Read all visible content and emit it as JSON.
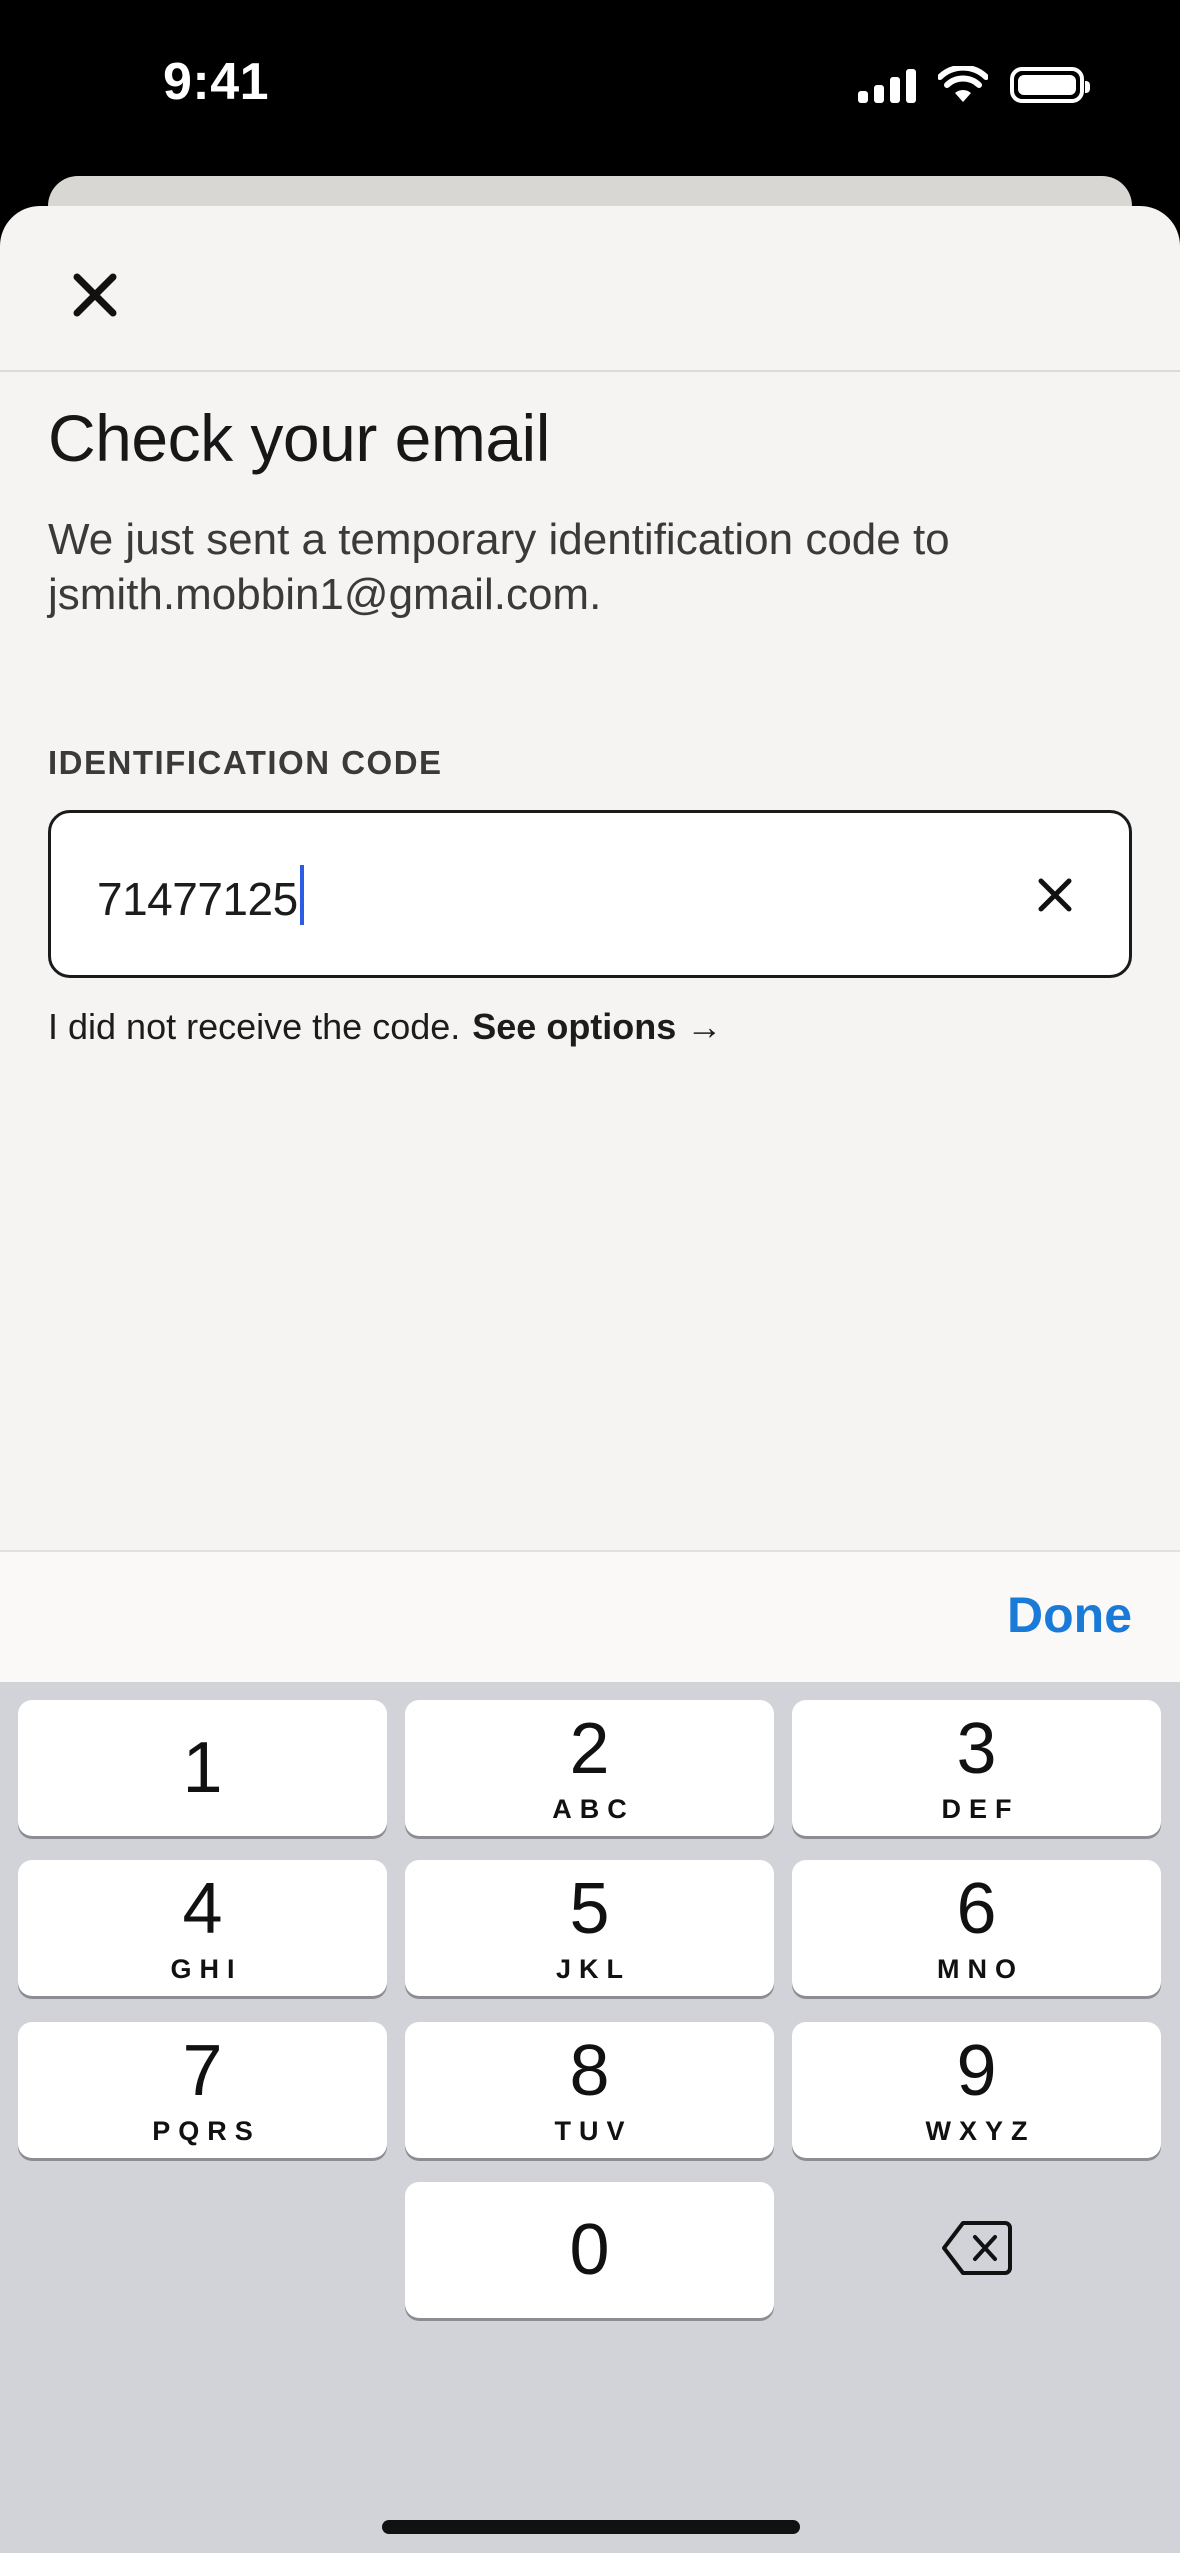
{
  "status_bar": {
    "time": "9:41",
    "signal_icon": "cellular-signal-icon",
    "wifi_icon": "wifi-icon",
    "battery_icon": "battery-icon"
  },
  "header": {
    "close_icon": "close-icon"
  },
  "content": {
    "title": "Check your email",
    "description": "We just sent a temporary identification code to jsmith.mobbin1@gmail.com.",
    "field_label": "IDENTIFICATION CODE",
    "code_value": "71477125",
    "clear_icon": "clear-icon",
    "helper_text": "I did not receive the code.",
    "helper_link": "See options →"
  },
  "toolbar": {
    "done_label": "Done",
    "accent_color": "#1a7ad8"
  },
  "keypad": {
    "keys": [
      {
        "digit": "1",
        "letters": ""
      },
      {
        "digit": "2",
        "letters": "ABC"
      },
      {
        "digit": "3",
        "letters": "DEF"
      },
      {
        "digit": "4",
        "letters": "GHI"
      },
      {
        "digit": "5",
        "letters": "JKL"
      },
      {
        "digit": "6",
        "letters": "MNO"
      },
      {
        "digit": "7",
        "letters": "PQRS"
      },
      {
        "digit": "8",
        "letters": "TUV"
      },
      {
        "digit": "9",
        "letters": "WXYZ"
      },
      {
        "digit": "0",
        "letters": ""
      }
    ],
    "delete_icon": "backspace-icon"
  }
}
